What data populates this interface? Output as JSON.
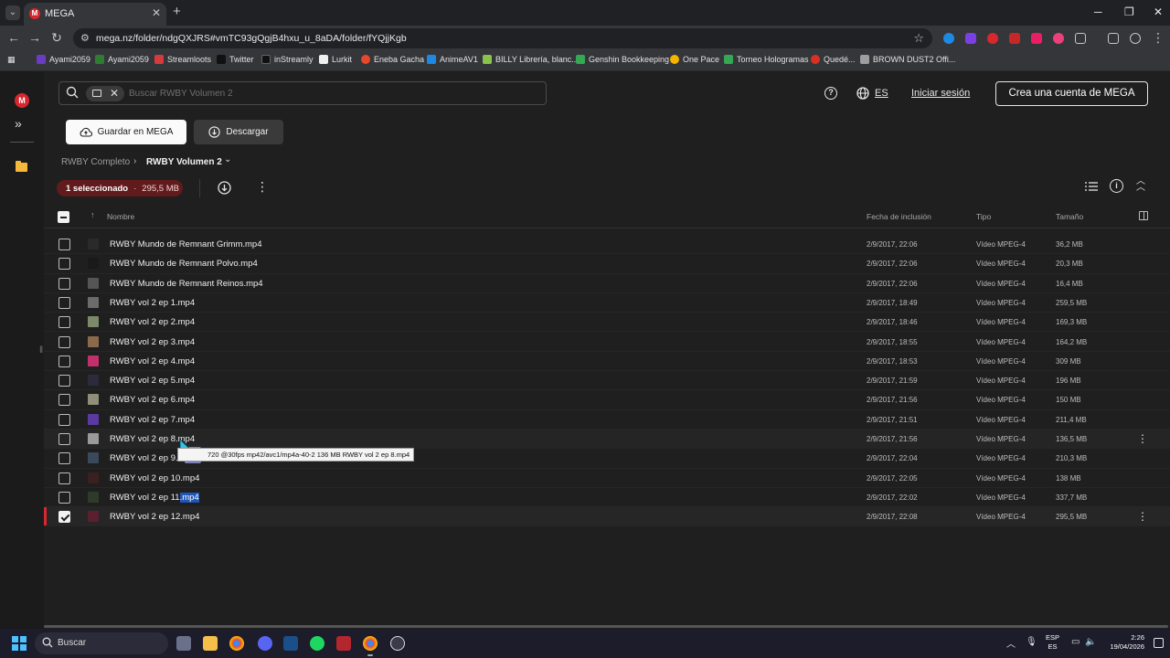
{
  "browser": {
    "tab_title": "MEGA",
    "url": "mega.nz/folder/ndgQXJRS#vmTC93gQgjB4hxu_u_8aDA/folder/fYQjjKgb",
    "bookmarks": [
      {
        "label": "Ayami2059",
        "color": "#6a3bc4"
      },
      {
        "label": "Ayami2059",
        "color": "#2f7d32"
      },
      {
        "label": "Streamloots",
        "color": "#d63b3b"
      },
      {
        "label": "Twitter",
        "color": "#111111"
      },
      {
        "label": "inStreamly",
        "color": "#111111"
      },
      {
        "label": "Lurkit",
        "color": "#f0f0f0"
      },
      {
        "label": "Eneba Gacha",
        "color": "#e8472b"
      },
      {
        "label": "AnimeAV1",
        "color": "#1e88e5"
      },
      {
        "label": "BILLY Librería, blanc...",
        "color": "#8bc34a"
      },
      {
        "label": "Genshin Bookkeeping",
        "color": "#34a853"
      },
      {
        "label": "One Pace",
        "color": "#f4b400"
      },
      {
        "label": "Torneo Hologramas",
        "color": "#34a853"
      },
      {
        "label": "Quedé...",
        "color": "#d93025"
      },
      {
        "label": "BROWN DUST2 Offi...",
        "color": "#9e9e9e"
      }
    ]
  },
  "header": {
    "search_placeholder": "Buscar RWBY Volumen 2",
    "language": "ES",
    "login": "Iniciar sesión",
    "signup": "Crea una cuenta de MEGA"
  },
  "actions": {
    "save": "Guardar en MEGA",
    "download": "Descargar"
  },
  "breadcrumb": {
    "parent": "RWBY Completo",
    "current": "RWBY Volumen 2"
  },
  "selection": {
    "count_label": "1 seleccionado",
    "separator": "·",
    "size": "295,5 MB"
  },
  "table": {
    "headers": {
      "name": "Nombre",
      "date": "Fecha de inclusión",
      "type": "Tipo",
      "size": "Tamaño"
    },
    "rows": [
      {
        "name": "RWBY Mundo de Remnant Grimm.mp4",
        "date": "2/9/2017, 22:06",
        "type": "Vídeo MPEG-4",
        "size": "36,2 MB",
        "thumb": "#2a2a2a"
      },
      {
        "name": "RWBY Mundo de Remnant Polvo.mp4",
        "date": "2/9/2017, 22:06",
        "type": "Vídeo MPEG-4",
        "size": "20,3 MB",
        "thumb": "#1a1a1a"
      },
      {
        "name": "RWBY Mundo de Remnant Reinos.mp4",
        "date": "2/9/2017, 22:06",
        "type": "Vídeo MPEG-4",
        "size": "16,4 MB",
        "thumb": "#555555"
      },
      {
        "name": "RWBY vol 2 ep 1.mp4",
        "date": "2/9/2017, 18:49",
        "type": "Vídeo MPEG-4",
        "size": "259,5 MB",
        "thumb": "#6b6b6b"
      },
      {
        "name": "RWBY vol 2 ep 2.mp4",
        "date": "2/9/2017, 18:46",
        "type": "Vídeo MPEG-4",
        "size": "169,3 MB",
        "thumb": "#7c8a6a"
      },
      {
        "name": "RWBY vol 2 ep 3.mp4",
        "date": "2/9/2017, 18:55",
        "type": "Vídeo MPEG-4",
        "size": "164,2 MB",
        "thumb": "#8a6a4a"
      },
      {
        "name": "RWBY vol 2 ep 4.mp4",
        "date": "2/9/2017, 18:53",
        "type": "Vídeo MPEG-4",
        "size": "309 MB",
        "thumb": "#c0306a"
      },
      {
        "name": "RWBY vol 2 ep 5.mp4",
        "date": "2/9/2017, 21:59",
        "type": "Vídeo MPEG-4",
        "size": "196 MB",
        "thumb": "#2b2b3b"
      },
      {
        "name": "RWBY vol 2 ep 6.mp4",
        "date": "2/9/2017, 21:56",
        "type": "Vídeo MPEG-4",
        "size": "150 MB",
        "thumb": "#8e8e7a"
      },
      {
        "name": "RWBY vol 2 ep 7.mp4",
        "date": "2/9/2017, 21:51",
        "type": "Vídeo MPEG-4",
        "size": "211,4 MB",
        "thumb": "#5a3aa0"
      },
      {
        "name": "RWBY vol 2 ep 8.mp4",
        "date": "2/9/2017, 21:56",
        "type": "Vídeo MPEG-4",
        "size": "136,5 MB",
        "thumb": "#9a9a9a"
      },
      {
        "name": "RWBY vol 2 ep 9.mp4",
        "date": "2/9/2017, 22:04",
        "type": "Vídeo MPEG-4",
        "size": "210,3 MB",
        "thumb": "#3a4a5a"
      },
      {
        "name": "RWBY vol 2 ep 10.mp4",
        "date": "2/9/2017, 22:05",
        "type": "Vídeo MPEG-4",
        "size": "138 MB",
        "thumb": "#3a2020"
      },
      {
        "name": "RWBY vol 2 ep 11.mp4",
        "date": "2/9/2017, 22:02",
        "type": "Vídeo MPEG-4",
        "size": "337,7 MB",
        "thumb": "#2f3a2a"
      },
      {
        "name": "RWBY vol 2 ep 12.mp4",
        "date": "2/9/2017, 22:08",
        "type": "Vídeo MPEG-4",
        "size": "295,5 MB",
        "thumb": "#5a2030"
      }
    ]
  },
  "tooltip": "720 @30fps mp42/avc1/mp4a-40-2 136 MB RWBY vol 2 ep 8.mp4",
  "taskbar": {
    "search_label": "Buscar",
    "lang_top": "ESP",
    "lang_bottom": "ES",
    "time": "2:26",
    "date": "19/04/2026"
  },
  "colors": {
    "accent": "#d9272e",
    "selected_badge": "#611b1d",
    "highlight": "#1f56b8"
  }
}
